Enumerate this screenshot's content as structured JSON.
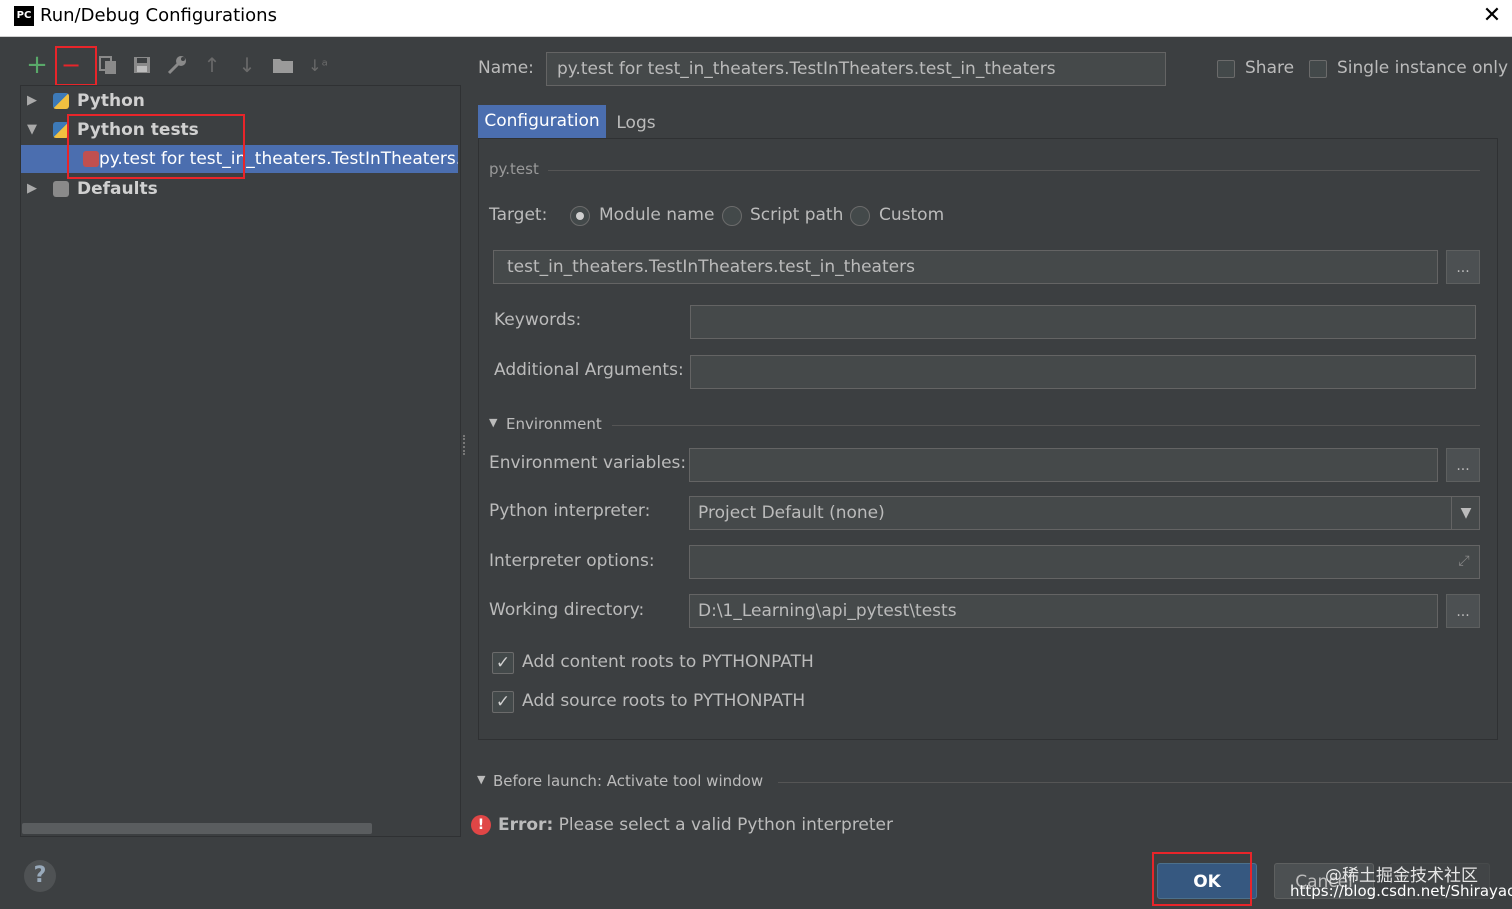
{
  "window": {
    "title": "Run/Debug Configurations",
    "app_icon": "PC"
  },
  "toolbar": {
    "add_icon": "+",
    "remove_icon": "−",
    "copy_icon": "copy-icon",
    "save_icon": "save-icon",
    "wrench_icon": "wrench-icon",
    "up_icon": "↑",
    "down_icon": "↓",
    "folder_icon": "folder-icon",
    "sort_icon": "↓ᵃ"
  },
  "tree": {
    "items": [
      {
        "label": "Python",
        "expanded": false
      },
      {
        "label": "Python tests",
        "expanded": true
      },
      {
        "label": "py.test for test_in_theaters.TestInTheaters.tes",
        "selected": true
      },
      {
        "label": "Defaults",
        "expanded": false
      }
    ]
  },
  "header": {
    "name_label": "Name:",
    "name_value": "py.test for test_in_theaters.TestInTheaters.test_in_theaters",
    "share_label": "Share",
    "single_instance_label": "Single instance only"
  },
  "tabs": [
    {
      "label": "Configuration"
    },
    {
      "label": "Logs"
    }
  ],
  "config": {
    "section_title": "py.test",
    "target_label": "Target:",
    "target_options": [
      "Module name",
      "Script path",
      "Custom"
    ],
    "target_selected": "Module name",
    "target_value": "test_in_theaters.TestInTheaters.test_in_theaters",
    "keywords_label": "Keywords:",
    "keywords_value": "",
    "additional_args_label": "Additional Arguments:",
    "additional_args_value": "",
    "environment_title": "Environment",
    "env_vars_label": "Environment variables:",
    "env_vars_value": "",
    "interpreter_label": "Python interpreter:",
    "interpreter_value": "Project Default (none)",
    "interp_options_label": "Interpreter options:",
    "interp_options_value": "",
    "workdir_label": "Working directory:",
    "workdir_value": "D:\\1_Learning\\api_pytest\\tests",
    "content_roots_label": "Add content roots to PYTHONPATH",
    "source_roots_label": "Add source roots to PYTHONPATH",
    "ellipsis": "..."
  },
  "before_launch": {
    "label": "Before launch: Activate tool window"
  },
  "error": {
    "prefix": "Error:",
    "message": " Please select a valid Python interpreter"
  },
  "buttons": {
    "ok": "OK",
    "cancel": "Cancel",
    "help": "?"
  },
  "watermark": {
    "line1": "@稀土掘金技术社区",
    "line2": "https://blog.csdn.net/Shirayao"
  },
  "colors": {
    "selection": "#4b6eaf",
    "highlight_box": "#e8252a",
    "error": "#e04646"
  }
}
